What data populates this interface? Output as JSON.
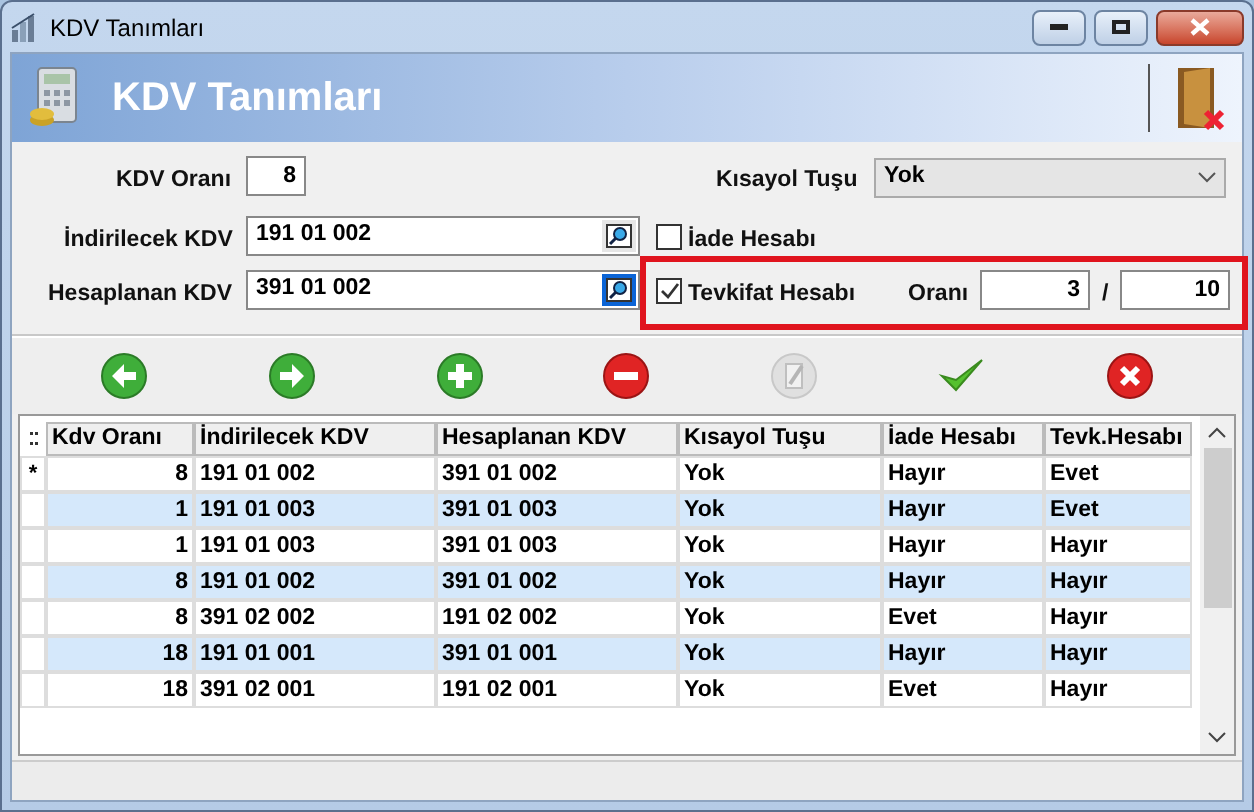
{
  "window": {
    "title": "KDV Tanımları"
  },
  "header": {
    "title": "KDV Tanımları"
  },
  "form": {
    "kdv_orani": {
      "label": "KDV Oranı",
      "value": "8"
    },
    "indirilecek": {
      "label": "İndirilecek KDV",
      "value": "191 01 002",
      "focused": false
    },
    "hesaplanan": {
      "label": "Hesaplanan KDV",
      "value": "391 01 002",
      "focused": true
    },
    "kisayol": {
      "label": "Kısayol Tuşu",
      "value": "Yok"
    },
    "iade": {
      "label": "İade Hesabı",
      "checked": false
    },
    "tevkifat": {
      "label": "Tevkifat Hesabı",
      "checked": true
    },
    "orani": {
      "label": "Oranı",
      "numerator": "3",
      "separator": "/",
      "denominator": "10"
    }
  },
  "toolbar": [
    {
      "kind": "back",
      "disabled": false
    },
    {
      "kind": "forward",
      "disabled": false
    },
    {
      "kind": "add",
      "disabled": false
    },
    {
      "kind": "delete",
      "disabled": false
    },
    {
      "kind": "edit",
      "disabled": true
    },
    {
      "kind": "save",
      "disabled": false
    },
    {
      "kind": "cancel",
      "disabled": false
    }
  ],
  "table": {
    "columns": [
      "Kdv Oranı",
      "İndirilecek KDV",
      "Hesaplanan KDV",
      "Kısayol Tuşu",
      "İade Hesabı",
      "Tevk.Hesabı"
    ],
    "rows": [
      {
        "indicator": "*",
        "cells": [
          "8",
          "191 01 002",
          "391 01 002",
          "Yok",
          "Hayır",
          "Evet"
        ]
      },
      {
        "cells": [
          "1",
          "191 01 003",
          "391 01 003",
          "Yok",
          "Hayır",
          "Evet"
        ]
      },
      {
        "cells": [
          "1",
          "191 01 003",
          "391 01 003",
          "Yok",
          "Hayır",
          "Hayır"
        ]
      },
      {
        "cells": [
          "8",
          "191 01 002",
          "391 01 002",
          "Yok",
          "Hayır",
          "Hayır"
        ]
      },
      {
        "cells": [
          "8",
          "391 02 002",
          "191 02 002",
          "Yok",
          "Evet",
          "Hayır"
        ]
      },
      {
        "cells": [
          "18",
          "191 01 001",
          "391 01 001",
          "Yok",
          "Hayır",
          "Hayır"
        ]
      },
      {
        "cells": [
          "18",
          "391 02 001",
          "191 02 001",
          "Yok",
          "Evet",
          "Hayır"
        ]
      }
    ]
  }
}
